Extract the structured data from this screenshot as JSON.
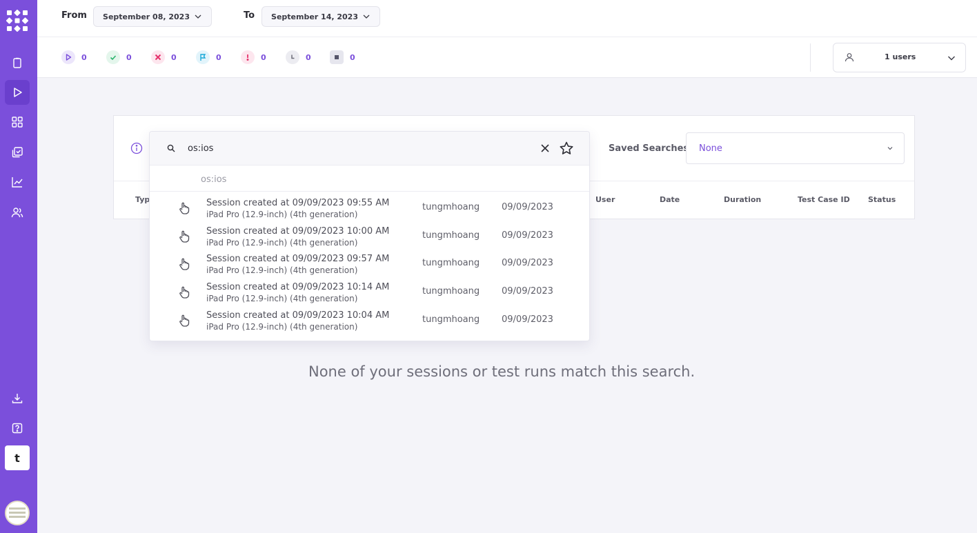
{
  "header": {
    "from_label": "From",
    "from_date": "September 08, 2023",
    "to_label": "To",
    "to_date": "September 14, 2023"
  },
  "stats": [
    {
      "icon": "play-icon",
      "count": "0",
      "color": "#7b4fdb",
      "bg": "#ece6fb"
    },
    {
      "icon": "check-icon",
      "count": "0",
      "color": "#27b36b",
      "bg": "#e4f6ec"
    },
    {
      "icon": "x-icon",
      "count": "0",
      "color": "#e5316b",
      "bg": "#fde6ee"
    },
    {
      "icon": "flag-icon",
      "count": "0",
      "color": "#19a8d8",
      "bg": "#e2f4fb"
    },
    {
      "icon": "exclamation-icon",
      "count": "0",
      "color": "#e5316b",
      "bg": "#fde6ee"
    },
    {
      "icon": "clock-icon",
      "count": "0",
      "color": "#6b6b78",
      "bg": "#ececf1"
    },
    {
      "icon": "stop-icon",
      "count": "0",
      "color": "#55556a",
      "bg": "#e6e6ee"
    }
  ],
  "users_filter": {
    "label": "1 users"
  },
  "search": {
    "value": "os:ios",
    "suggestion": "os:ios",
    "results": [
      {
        "title": "Session created at 09/09/2023 09:55 AM",
        "device": "iPad Pro (12.9-inch) (4th generation)",
        "user": "tungmhoang",
        "date": "09/09/2023"
      },
      {
        "title": "Session created at 09/09/2023 10:00 AM",
        "device": "iPad Pro (12.9-inch) (4th generation)",
        "user": "tungmhoang",
        "date": "09/09/2023"
      },
      {
        "title": "Session created at 09/09/2023 09:57 AM",
        "device": "iPad Pro (12.9-inch) (4th generation)",
        "user": "tungmhoang",
        "date": "09/09/2023"
      },
      {
        "title": "Session created at 09/09/2023 10:14 AM",
        "device": "iPad Pro (12.9-inch) (4th generation)",
        "user": "tungmhoang",
        "date": "09/09/2023"
      },
      {
        "title": "Session created at 09/09/2023 10:04 AM",
        "device": "iPad Pro (12.9-inch) (4th generation)",
        "user": "tungmhoang",
        "date": "09/09/2023"
      }
    ]
  },
  "saved_searches": {
    "label": "Saved Searches",
    "value": "None"
  },
  "table": {
    "columns": [
      "Typ",
      "User",
      "Date",
      "Duration",
      "Test Case ID",
      "Status"
    ]
  },
  "empty_message": "None of your sessions or test runs match this search.",
  "workspace_tile": "t",
  "colors": {
    "accent": "#7b4fdb",
    "sidebar": "#7b4fdb"
  }
}
